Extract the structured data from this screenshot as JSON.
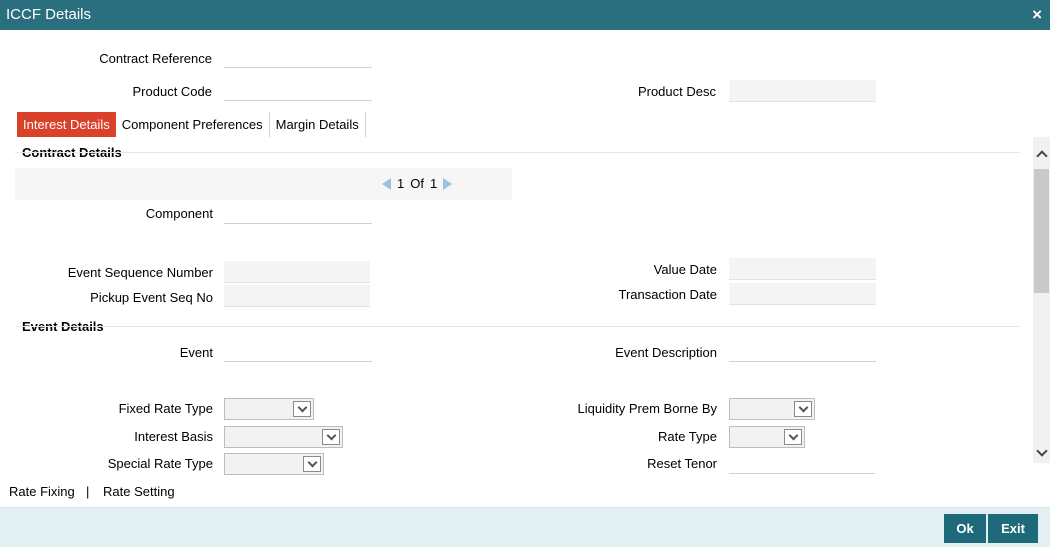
{
  "window": {
    "title": "ICCF Details",
    "close_icon": "×"
  },
  "header": {
    "contract_reference_label": "Contract Reference",
    "contract_reference_value": "",
    "product_code_label": "Product Code",
    "product_code_value": "",
    "product_desc_label": "Product Desc",
    "product_desc_value": ""
  },
  "tabs": [
    {
      "label": "Interest Details",
      "active": true
    },
    {
      "label": "Component Preferences",
      "active": false
    },
    {
      "label": "Margin Details",
      "active": false
    }
  ],
  "contract_details": {
    "title": "Contract Details",
    "pager": {
      "current": "1",
      "of_label": "Of",
      "total": "1"
    },
    "component_label": "Component",
    "component_value": "",
    "event_seq_label": "Event Sequence Number",
    "pickup_event_seq_label": "Pickup Event Seq No",
    "value_date_label": "Value Date",
    "transaction_date_label": "Transaction Date"
  },
  "event_details": {
    "title": "Event Details",
    "event_label": "Event",
    "event_desc_label": "Event Description",
    "fixed_rate_type_label": "Fixed Rate Type",
    "interest_basis_label": "Interest Basis",
    "special_rate_type_label": "Special Rate Type",
    "liquidity_prem_label": "Liquidity Prem Borne By",
    "rate_type_label": "Rate Type",
    "reset_tenor_label": "Reset Tenor"
  },
  "bottom_links": {
    "rate_fixing": "Rate Fixing",
    "separator": "|",
    "rate_setting": "Rate Setting"
  },
  "footer": {
    "ok_label": "Ok",
    "exit_label": "Exit"
  },
  "colors": {
    "title_bar": "#2a6f7e",
    "active_tab": "#d9412b",
    "button": "#1e6a7a",
    "footer_bg": "#e3f0f3"
  },
  "icons": {
    "close": "close-icon",
    "prev": "prev-arrow-icon",
    "next": "next-arrow-icon",
    "dropdown": "chevron-down-icon",
    "scroll_up": "chevron-up-icon",
    "scroll_down": "chevron-down-icon"
  }
}
